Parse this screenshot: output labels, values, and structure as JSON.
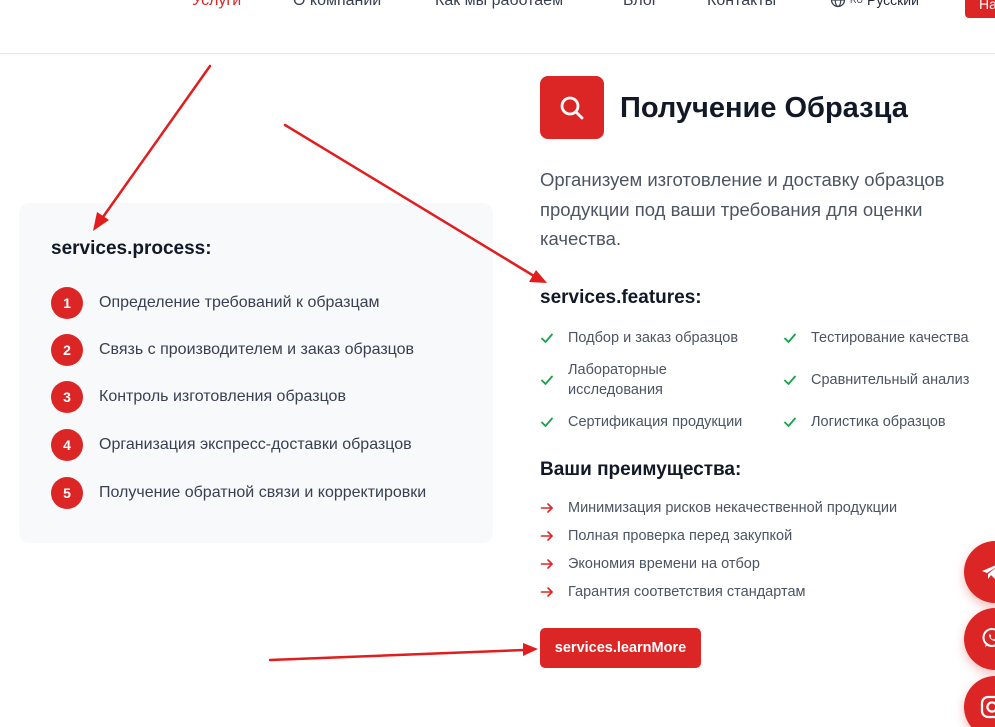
{
  "nav": {
    "items": [
      {
        "label": "Услуги",
        "active": true
      },
      {
        "label": "О компании",
        "active": false
      },
      {
        "label": "Как мы работаем",
        "active": false
      },
      {
        "label": "Блог",
        "active": false
      },
      {
        "label": "Контакты",
        "active": false
      }
    ],
    "language": {
      "flag": "RU",
      "label": "Русский"
    },
    "cta_label": "На"
  },
  "process": {
    "title": "services.process:",
    "steps": [
      {
        "num": "1",
        "text": "Определение требований к образцам"
      },
      {
        "num": "2",
        "text": "Связь с производителем и заказ образцов"
      },
      {
        "num": "3",
        "text": "Контроль изготовления образцов"
      },
      {
        "num": "4",
        "text": "Организация экспресс-доставки образцов"
      },
      {
        "num": "5",
        "text": "Получение обратной связи и корректировки"
      }
    ]
  },
  "service": {
    "icon": "search-icon",
    "title": "Получение Образца",
    "description": "Организуем изготовление и доставку образцов продукции под ваши требования для оценки качества."
  },
  "features": {
    "title": "services.features:",
    "items": [
      "Подбор и заказ образцов",
      "Тестирование качества",
      "Лабораторные исследования",
      "Сравнительный анализ",
      "Сертификация продукции",
      "Логистика образцов"
    ]
  },
  "advantages": {
    "title": "Ваши преимущества:",
    "items": [
      "Минимизация рисков некачественной продукции",
      "Полная проверка перед закупкой",
      "Экономия времени на отбор",
      "Гарантия соответствия стандартам"
    ]
  },
  "learn_more_label": "services.learnMore",
  "floating": [
    "telegram-icon",
    "whatsapp-icon",
    "instagram-icon"
  ],
  "colors": {
    "accent": "#dc2626",
    "check": "#16a34a",
    "annotation": "#e11d1d"
  }
}
